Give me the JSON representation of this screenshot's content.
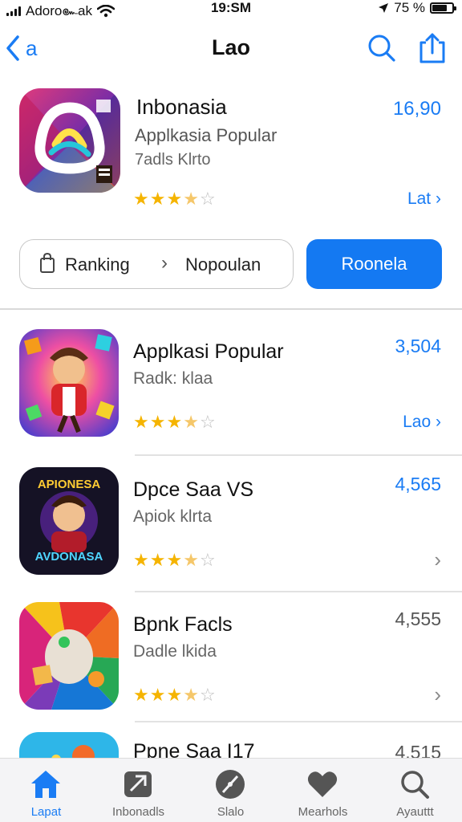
{
  "status_bar": {
    "carrier": "Adoro๛ak",
    "time": "19:SM",
    "battery": "75 %",
    "battery_level": 0.75
  },
  "nav": {
    "back_label": "a",
    "title": "Lao"
  },
  "featured": {
    "name": "Inbonasia",
    "subtitle": "Applkasia Popular",
    "meta": "7adls Klrto",
    "price": "16,90",
    "rating": 3.5,
    "link": "Lat"
  },
  "ranking": {
    "label": "Ranking",
    "value": "Nopoulan",
    "button": "Roonela"
  },
  "list": [
    {
      "title": "Applkasi Popular",
      "subtitle": "Radk: klaa",
      "rating": 3.5,
      "number": "3,504",
      "number_color": "#1a7cf4",
      "link": "Lao",
      "trailing": "link"
    },
    {
      "title": "Dpce Saa VS",
      "subtitle": "Apiok klrta",
      "rating": 3.5,
      "number": "4,565",
      "number_color": "#1a7cf4",
      "link": "",
      "trailing": "chevron",
      "icon_text_top": "APIONESA",
      "icon_text_bottom": "AVDONASA"
    },
    {
      "title": "Bpnk Facls",
      "subtitle": "Dadle lkida",
      "rating": 3.5,
      "number": "4,555",
      "number_color": "#555555",
      "link": "",
      "trailing": "chevron"
    },
    {
      "title": "Ppne Saa I17",
      "subtitle": "",
      "rating": 0,
      "number": "4,515",
      "number_color": "#555555",
      "link": "",
      "trailing": "none"
    }
  ],
  "tabs": [
    {
      "label": "Lapat",
      "icon": "home-icon",
      "active": true
    },
    {
      "label": "Inbonadls",
      "icon": "apps-icon",
      "active": false
    },
    {
      "label": "Slalo",
      "icon": "compass-icon",
      "active": false
    },
    {
      "label": "Mearhols",
      "icon": "heart-icon",
      "active": false
    },
    {
      "label": "Ayauttt",
      "icon": "search-icon",
      "active": false
    }
  ],
  "colors": {
    "accent": "#1a7cf4",
    "button": "#1479f2",
    "star": "#f5b400"
  }
}
